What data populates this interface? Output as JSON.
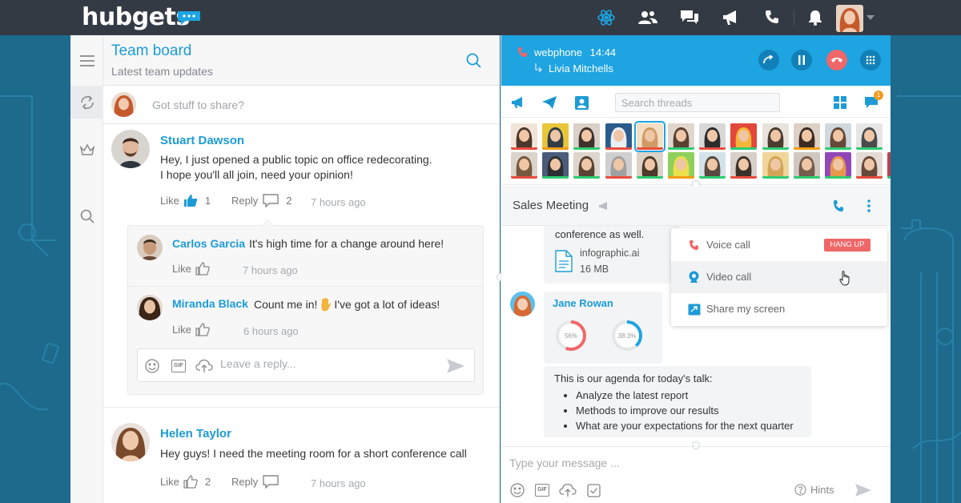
{
  "app": {
    "logo_text": "hubgets",
    "colors": {
      "accent": "#1c9bd7",
      "topbar": "#333a44",
      "background": "#1d6a8c",
      "call_bar": "#1ea4e0",
      "hangup": "#ef6768"
    }
  },
  "topnav": {
    "icons": [
      "atom-icon",
      "contacts-icon",
      "chat-icon",
      "megaphone-icon",
      "phone-log-icon",
      "bell-icon"
    ],
    "avatar_menu": "chevron-down-icon"
  },
  "sidebar": {
    "items": [
      "menu-icon",
      "sync-icon",
      "crown-icon",
      "search-icon"
    ]
  },
  "board": {
    "title": "Team board",
    "subtitle": "Latest team updates",
    "share_placeholder": "Got stuff to share?",
    "posts": [
      {
        "author": "Stuart Dawson",
        "lines": [
          "Hey, I just opened a public topic on office redecorating.",
          "I hope you'll all join, need your opinion!"
        ],
        "like_label": "Like",
        "like_count": "1",
        "reply_label": "Reply",
        "reply_count": "2",
        "time": "7 hours ago"
      },
      {
        "author": "Helen Taylor",
        "lines": [
          "Hey guys! I need the meeting room for a short conference call"
        ],
        "like_label": "Like",
        "like_count": "2",
        "reply_label": "Reply",
        "time": "7 hours ago"
      }
    ],
    "replies": [
      {
        "author": "Carlos Garcia",
        "text": "It's high time for a change around here!",
        "like_label": "Like",
        "time": "7 hours ago"
      },
      {
        "author": "Miranda Black",
        "text": "Count me in!",
        "text_after": "I've got a lot of ideas!",
        "like_label": "Like",
        "time": "6 hours ago"
      }
    ],
    "reply_placeholder": "Leave a reply...",
    "gif_label": "GIF"
  },
  "chat": {
    "call": {
      "title": "webphone",
      "duration": "14:44",
      "contact": "Livia Mitchells"
    },
    "thread_search_placeholder": "Search threads",
    "notification_count": "1",
    "conversation_title": "Sales Meeting",
    "messages": {
      "prev_text": "conference as well.",
      "file_name": "infographic.ai",
      "file_size": "16 MB",
      "jane_name": "Jane Rowan",
      "donut_1": "56%",
      "donut_1_value": 56,
      "donut_2": "38.3%",
      "donut_2_value": 38.3,
      "agenda_title": "This is our agenda for today's talk:",
      "agenda_items": [
        "Analyze the latest report",
        "Methods to improve our results",
        "What are your expectations for the next quarter"
      ]
    },
    "call_menu": {
      "voice": "Voice call",
      "hangup": "HANG UP",
      "video": "Video call",
      "share": "Share my screen"
    },
    "composer_placeholder": "Type your message ...",
    "gif_label": "GIF",
    "hints_label": "Hints"
  }
}
